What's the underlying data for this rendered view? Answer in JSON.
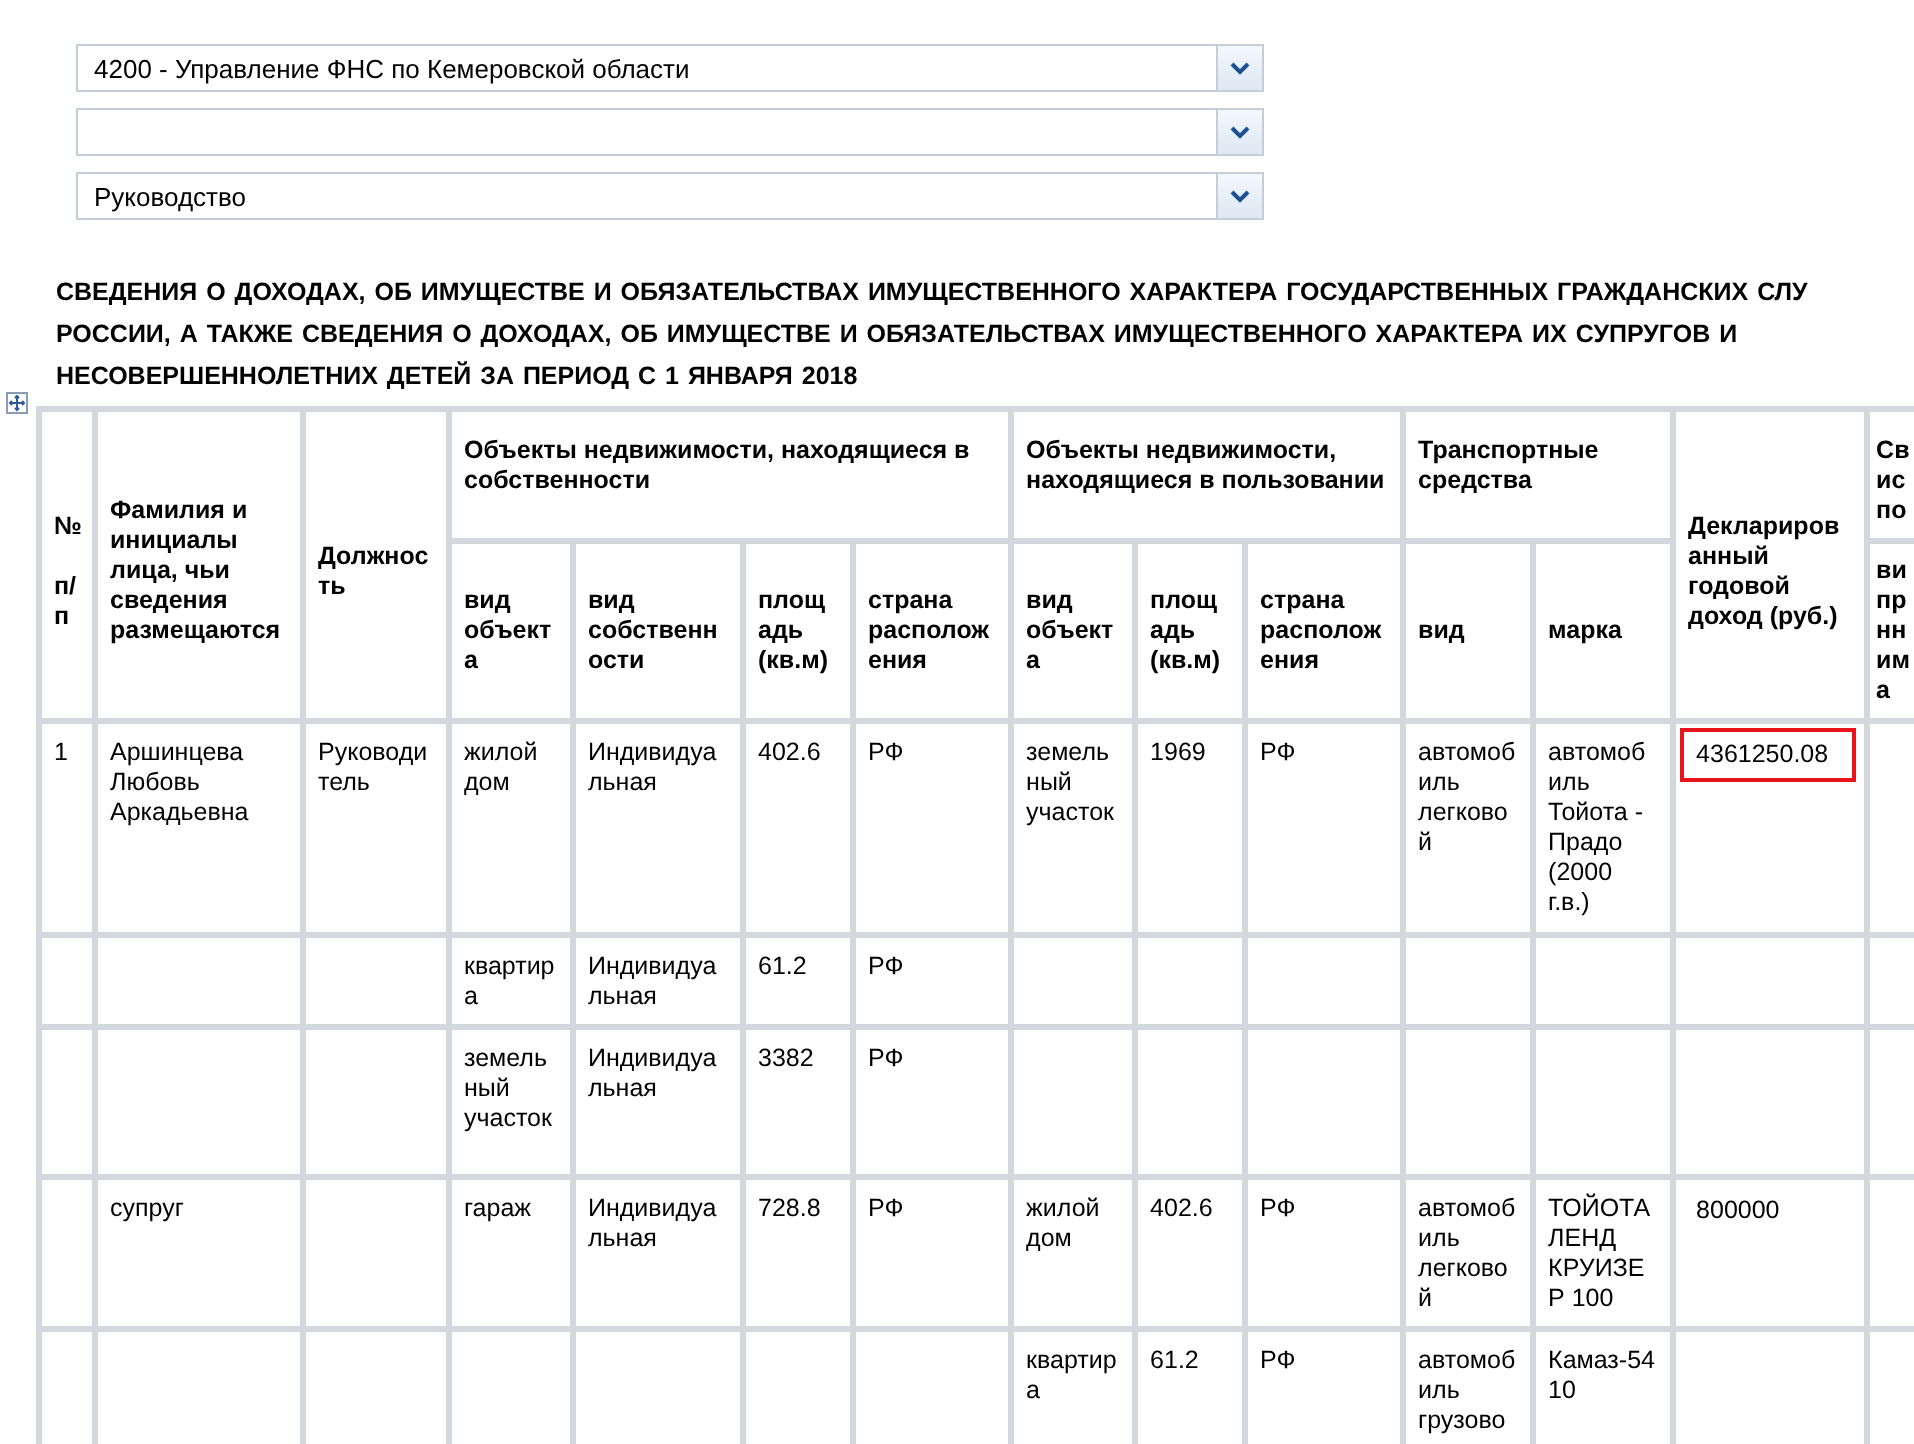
{
  "filters": [
    {
      "kind": "dropdown",
      "value": "4200 - Управление ФНС по Кемеровской области"
    },
    {
      "kind": "dropdown"
    },
    {
      "kind": "dropdown",
      "value": "Руководство"
    }
  ],
  "title": "СВЕДЕНИЯ О ДОХОДАХ, ОБ ИМУЩЕСТВЕ И ОБЯЗАТЕЛЬСТВАХ ИМУЩЕСТВЕННОГО ХАРАКТЕРА ГОСУДАРСТВЕННЫХ ГРАЖДАНСКИХ СЛУ\nРОССИИ, А ТАКЖЕ СВЕДЕНИЯ О ДОХОДАХ, ОБ ИМУЩЕСТВЕ И ОБЯЗАТЕЛЬСТВАХ ИМУЩЕСТВЕННОГО ХАРАКТЕРА ИХ СУПРУГОВ И\nНЕСОВЕРШЕННОЛЕТНИХ ДЕТЕЙ ЗА ПЕРИОД С 1 ЯНВАРЯ 2018",
  "table": {
    "header_top": [
      {
        "text": "№\n\nп/п",
        "kind": "full"
      },
      {
        "text": "Фамилия и инициалы лица, чьи сведения размещаются",
        "kind": "full"
      },
      {
        "text": "Должность",
        "kind": "full"
      },
      {
        "text": "Объекты недвижимости,  находящиеся в собственности",
        "kind": "group"
      },
      {
        "text": "Объекты недвижимости, находящиеся в пользовании",
        "kind": "group"
      },
      {
        "text": "Транспортные средства",
        "kind": "group"
      },
      {
        "text": "Декларированный годовой доход (руб.)",
        "kind": "full"
      },
      {
        "text": "Св ис по",
        "kind": "group"
      }
    ],
    "header_sub": [
      "вид объекта",
      "вид собственности",
      "площадь (кв.м)",
      "страна расположения",
      "вид объекта",
      "площадь (кв.м)",
      "страна расположения",
      "вид",
      "марка",
      "ви пр нн им а"
    ],
    "rows": [
      {
        "cells": [
          "1",
          "Аршинцева Любовь Аркадьевна",
          "Руководитель",
          "жилой дом",
          "Индивидуальная",
          "402.6",
          "РФ",
          "земельный участок",
          "1969",
          "РФ",
          "автомобиль легковой",
          "автомобиль Тойота - Прадо (2000 г.в.)",
          "4361250.08"
        ],
        "income_highlighted": true
      },
      {
        "cells": [
          null,
          null,
          null,
          "квартира",
          "Индивидуальная",
          "61.2",
          "РФ",
          null,
          null,
          null,
          null,
          null,
          null
        ],
        "income_highlighted": false
      },
      {
        "cells": [
          null,
          null,
          null,
          "земельный участок",
          "Индивидуальная",
          "3382",
          "РФ",
          null,
          null,
          null,
          null,
          null,
          null
        ],
        "income_highlighted": false
      },
      {
        "cells": [
          null,
          "супруг",
          null,
          "гараж",
          "Индивидуальная",
          "728.8",
          "РФ",
          "жилой дом",
          "402.6",
          "РФ",
          "автомобиль легковой",
          "ТОЙОТА ЛЕНД КРУИЗЕР 100",
          "800000"
        ],
        "income_highlighted": false
      },
      {
        "cells": [
          null,
          null,
          null,
          null,
          null,
          null,
          null,
          "квартира",
          "61.2",
          "РФ",
          "автомобиль грузово",
          "Камаз-5410",
          null
        ],
        "income_highlighted": false
      }
    ]
  }
}
